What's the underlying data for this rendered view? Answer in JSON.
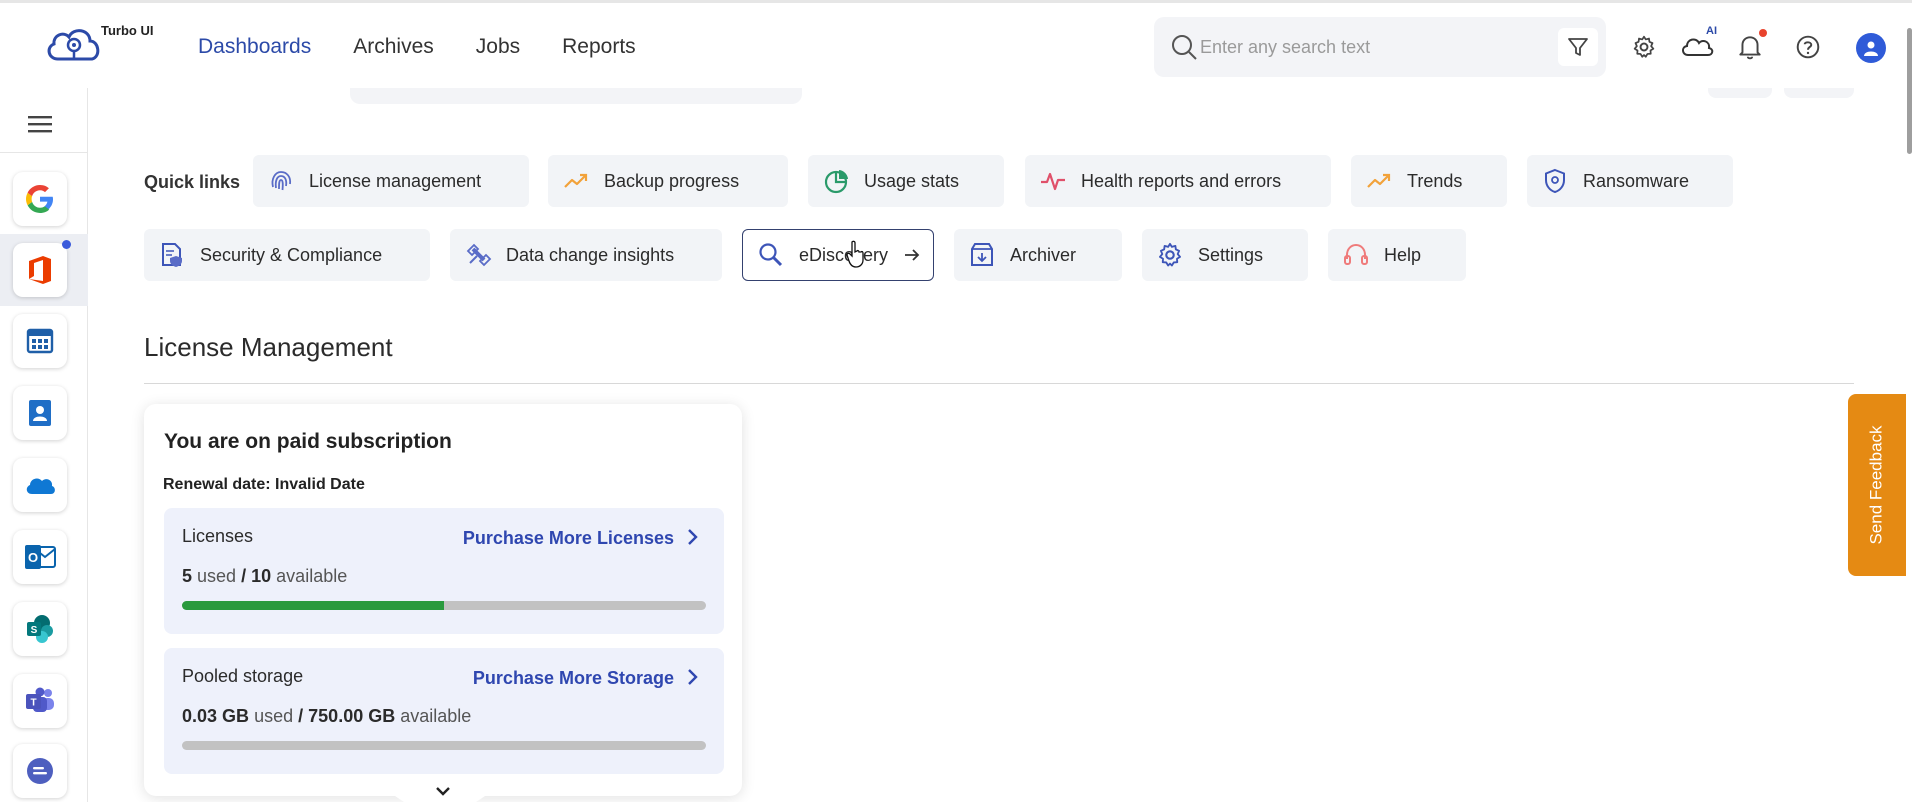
{
  "header": {
    "logo_text": "Turbo UI",
    "nav": [
      {
        "label": "Dashboards",
        "active": true
      },
      {
        "label": "Archives",
        "active": false
      },
      {
        "label": "Jobs",
        "active": false
      },
      {
        "label": "Reports",
        "active": false
      }
    ],
    "search_placeholder": "Enter any search text",
    "ai_badge": "AI",
    "icons": [
      "filter-icon",
      "gear-icon",
      "cloud-ai-icon",
      "bell-icon",
      "help-icon",
      "user-avatar-icon"
    ]
  },
  "sidebar": {
    "apps": [
      {
        "name": "google-icon"
      },
      {
        "name": "office-icon",
        "selected": true,
        "has_dot": true
      },
      {
        "name": "calendar-icon"
      },
      {
        "name": "contacts-icon"
      },
      {
        "name": "onedrive-icon"
      },
      {
        "name": "outlook-icon"
      },
      {
        "name": "sharepoint-icon"
      },
      {
        "name": "teams-icon"
      },
      {
        "name": "chat-icon"
      }
    ]
  },
  "quick_links": {
    "label": "Quick links",
    "items": [
      {
        "label": "License management",
        "icon": "fingerprint-icon"
      },
      {
        "label": "Backup progress",
        "icon": "trend-up-icon"
      },
      {
        "label": "Usage stats",
        "icon": "pie-chart-icon"
      },
      {
        "label": "Health reports and errors",
        "icon": "pulse-icon"
      },
      {
        "label": "Trends",
        "icon": "trend-up-icon"
      },
      {
        "label": "Ransomware",
        "icon": "shield-icon"
      },
      {
        "label": "Security & Compliance",
        "icon": "document-shield-icon"
      },
      {
        "label": "Data change insights",
        "icon": "satellite-icon"
      },
      {
        "label": "eDiscovery",
        "icon": "magnifier-icon",
        "active": true
      },
      {
        "label": "Archiver",
        "icon": "archive-box-icon"
      },
      {
        "label": "Settings",
        "icon": "gear-icon"
      },
      {
        "label": "Help",
        "icon": "headset-icon"
      }
    ]
  },
  "section": {
    "title": "License Management"
  },
  "subscription": {
    "title": "You are on paid subscription",
    "renewal": "Renewal date: Invalid Date",
    "licenses": {
      "title": "Licenses",
      "link": "Purchase More Licenses",
      "used": "5",
      "used_label": "used",
      "separator": "/",
      "available": "10",
      "available_label": "available",
      "fraction": 0.5
    },
    "storage": {
      "title": "Pooled storage",
      "link": "Purchase More Storage",
      "used": "0.03 GB",
      "used_label": "used",
      "separator": "/",
      "available": "750.00 GB",
      "available_label": "available",
      "fraction": 0.0
    }
  },
  "feedback": {
    "label": "Send Feedback"
  },
  "colors": {
    "accent": "#2c4aa8",
    "feedback": "#e58a13",
    "progress": "#2a9a3e"
  }
}
